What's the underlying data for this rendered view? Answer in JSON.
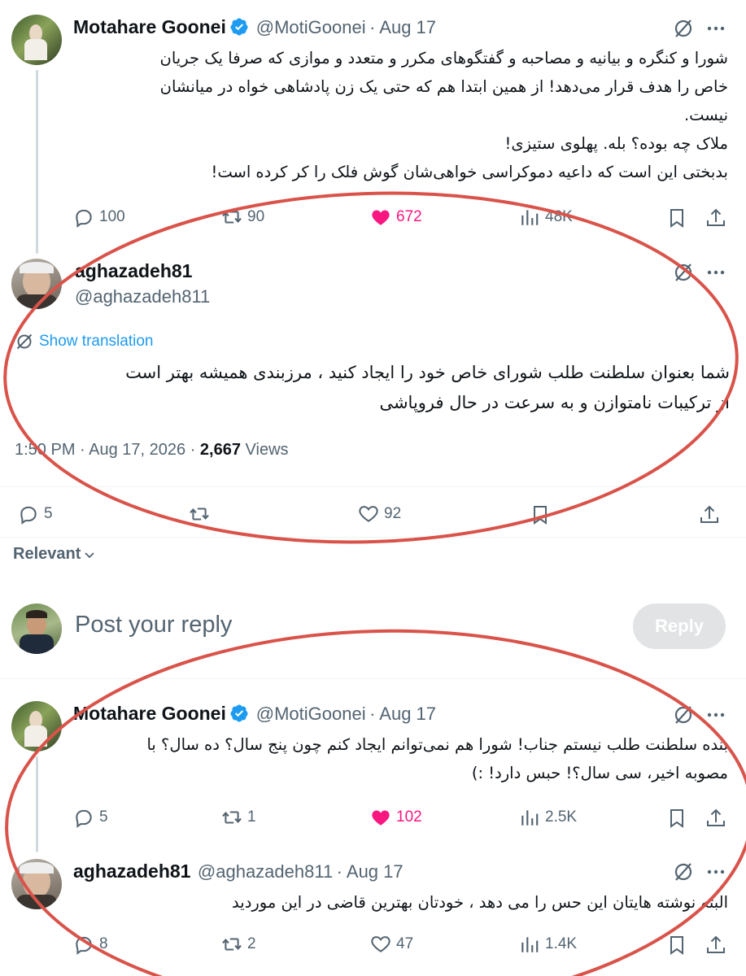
{
  "tweet1": {
    "name": "Motahare Goonei",
    "handle": "@MotiGoonei",
    "date": "Aug 17",
    "lines": [
      "شورا و کنگره و بیانیه و مصاحبه و گفتگوهای مکرر و متعدد و موازی که صرفا یک جریان",
      "خاص را هدف قرار می‌دهد! از همین ابتدا هم که حتی یک زن پادشاهی خواه در میانشان",
      "نیست.",
      "ملاک چه بوده؟ بله. پهلوی ستیزی!",
      "بدبختی این است که داعیه دموکراسی خواهی‌شان گوش فلک را کر کرده است!"
    ],
    "replies": "100",
    "retweets": "90",
    "likes": "672",
    "views": "48K"
  },
  "main_tweet": {
    "name": "aghazadeh81",
    "handle": "@aghazadeh811",
    "show_translation": "Show translation",
    "lines": [
      "شما بعنوان سلطنت طلب شورای خاص خود را ایجاد کنید ، مرزبندی همیشه بهتر است",
      "از ترکیبات نامتوازن و به سرعت در حال فروپاشی"
    ],
    "time": "1:50 PM · Aug 17, 2026 · ",
    "views_count": "2,667",
    "views_label": " Views",
    "replies": "5",
    "likes": "92"
  },
  "sort": {
    "label": "Relevant"
  },
  "compose": {
    "placeholder": "Post your reply",
    "button": "Reply"
  },
  "tweet3": {
    "name": "Motahare Goonei",
    "handle": "@MotiGoonei",
    "date": "Aug 17",
    "lines": [
      "بنده سلطنت طلب نیستم جناب! شورا هم نمی‌توانم ایجاد کنم چون پنج سال؟ ده سال؟ با",
      "مصوبه اخیر، سی سال؟! حبس دارد! :)"
    ],
    "replies": "5",
    "retweets": "1",
    "likes": "102",
    "views": "2.5K"
  },
  "tweet4": {
    "name": "aghazadeh81",
    "handle": "@aghazadeh811",
    "date": "Aug 17",
    "lines": [
      "البته نوشته هایتان این حس را می دهد ، خودتان بهترین قاضی در این موردید"
    ],
    "replies": "8",
    "retweets": "2",
    "likes": "47",
    "views": "1.4K"
  },
  "colors": {
    "accent": "#1d9bf0",
    "like_pink": "#f91880",
    "annotation_red": "#d9534a",
    "muted": "#536471"
  }
}
